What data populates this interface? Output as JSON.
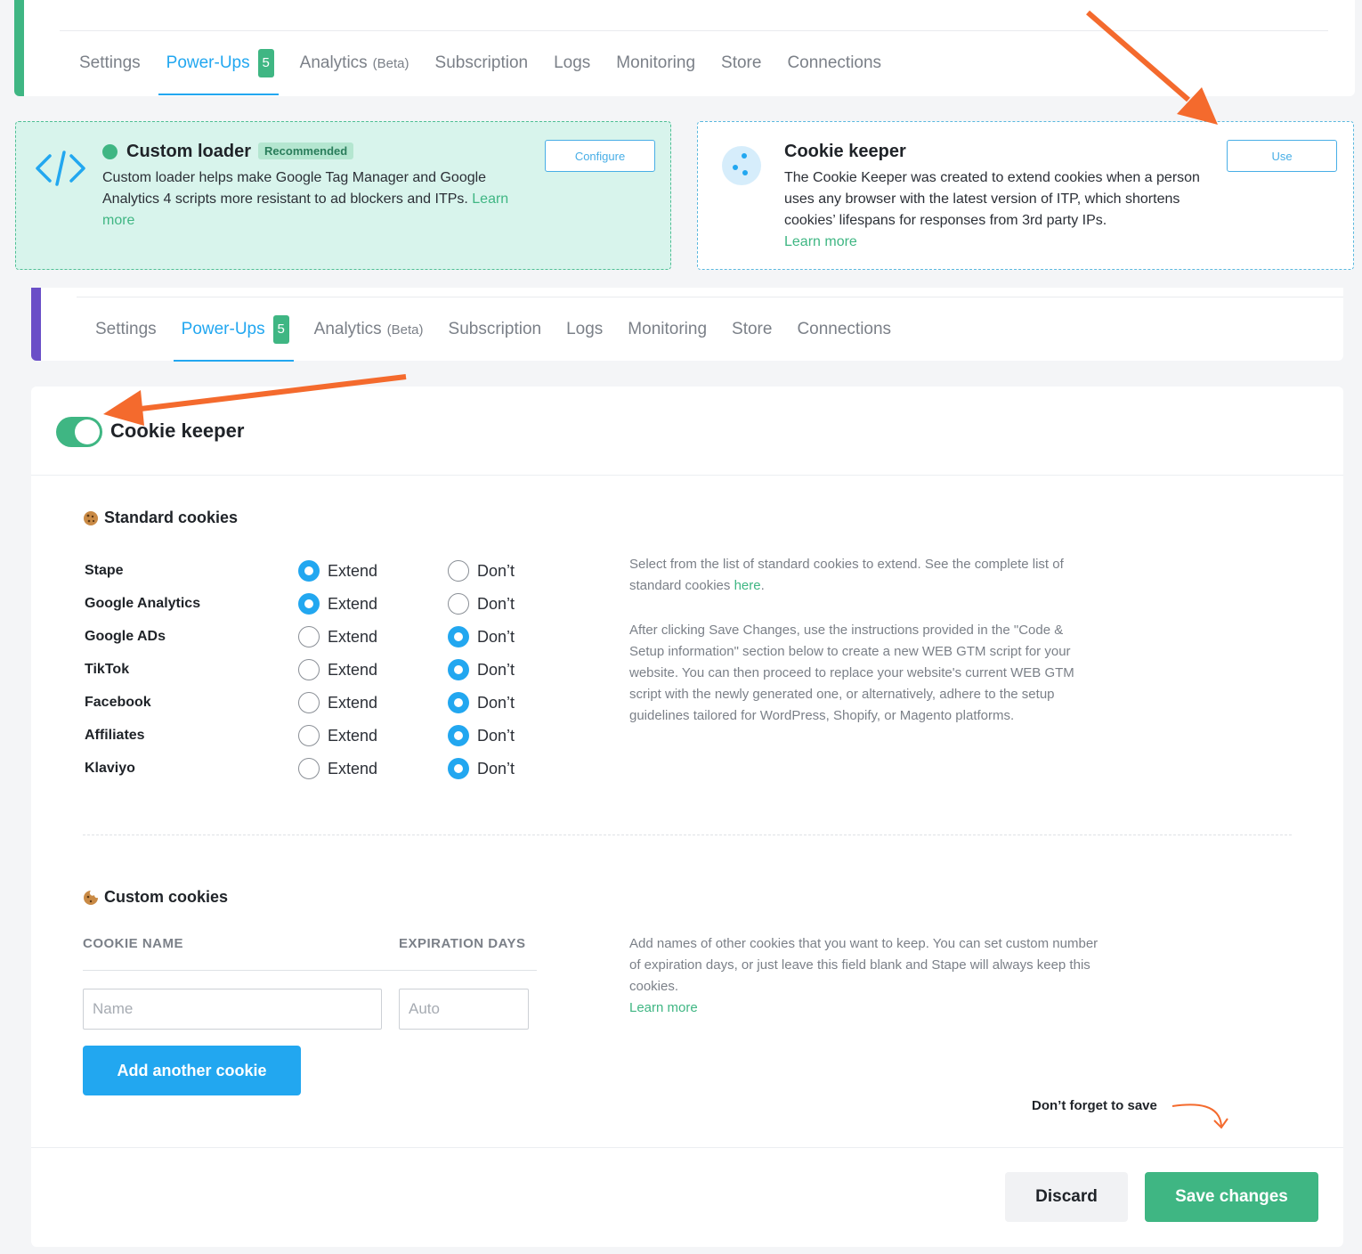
{
  "nav_top": {
    "tabs": [
      {
        "label": "Settings"
      },
      {
        "label": "Power-Ups",
        "badge": "5"
      },
      {
        "label": "Analytics",
        "suffix": "(Beta)"
      },
      {
        "label": "Subscription"
      },
      {
        "label": "Logs"
      },
      {
        "label": "Monitoring"
      },
      {
        "label": "Store"
      },
      {
        "label": "Connections"
      }
    ],
    "accent_color": "#3fb683"
  },
  "cards": {
    "custom_loader": {
      "title": "Custom loader",
      "tag": "Recommended",
      "description": "Custom loader helps make Google Tag Manager and Google Analytics 4 scripts more resistant to ad blockers and ITPs.",
      "learn_more": "Learn more",
      "button": "Configure",
      "icon": "code-icon"
    },
    "cookie_keeper": {
      "title": "Cookie keeper",
      "description": "The Cookie Keeper was created to extend cookies when a person uses any browser with the latest version of ITP, which shortens cookies’ lifespans for responses from 3rd party IPs.",
      "learn_more": "Learn more",
      "button": "Use",
      "icon": "cookie-icon"
    }
  },
  "nav_bottom": {
    "tabs": [
      {
        "label": "Settings"
      },
      {
        "label": "Power-Ups",
        "badge": "5"
      },
      {
        "label": "Analytics",
        "suffix": "(Beta)"
      },
      {
        "label": "Subscription"
      },
      {
        "label": "Logs"
      },
      {
        "label": "Monitoring"
      },
      {
        "label": "Store"
      },
      {
        "label": "Connections"
      }
    ],
    "accent_color": "#6a4fc7"
  },
  "panel": {
    "title": "Cookie keeper",
    "enabled": true,
    "standard": {
      "heading": "Standard cookies",
      "options": {
        "extend": "Extend",
        "dont": "Don’t"
      },
      "rows": [
        {
          "name": "Stape",
          "selected": "extend"
        },
        {
          "name": "Google Analytics",
          "selected": "extend"
        },
        {
          "name": "Google ADs",
          "selected": "dont"
        },
        {
          "name": "TikTok",
          "selected": "dont"
        },
        {
          "name": "Facebook",
          "selected": "dont"
        },
        {
          "name": "Affiliates",
          "selected": "dont"
        },
        {
          "name": "Klaviyo",
          "selected": "dont"
        }
      ],
      "help1": "Select from the list of standard cookies to extend. See the complete list of standard cookies ",
      "help1_link": "here",
      "help2": "After clicking Save Changes, use the instructions provided in the \"Code & Setup information\" section below to create a new WEB GTM script for your website. You can then proceed to replace your website's current WEB GTM script with the newly generated one, or alternatively, adhere to the setup guidelines tailored for WordPress, Shopify, or Magento platforms."
    },
    "custom": {
      "heading": "Custom cookies",
      "col_name": "COOKIE NAME",
      "col_days": "EXPIRATION DAYS",
      "name_placeholder": "Name",
      "days_placeholder": "Auto",
      "add_button": "Add another cookie",
      "help": "Add names of other cookies that you want to keep. You can set custom number of expiration days, or just leave this field blank and Stape will always keep this cookies.",
      "learn_more": "Learn more"
    },
    "reminder": "Don’t forget to save",
    "discard": "Discard",
    "save": "Save changes"
  },
  "colors": {
    "primary_blue": "#22a7f0",
    "green": "#3fb683",
    "annotation_arrow": "#f46a2d"
  }
}
